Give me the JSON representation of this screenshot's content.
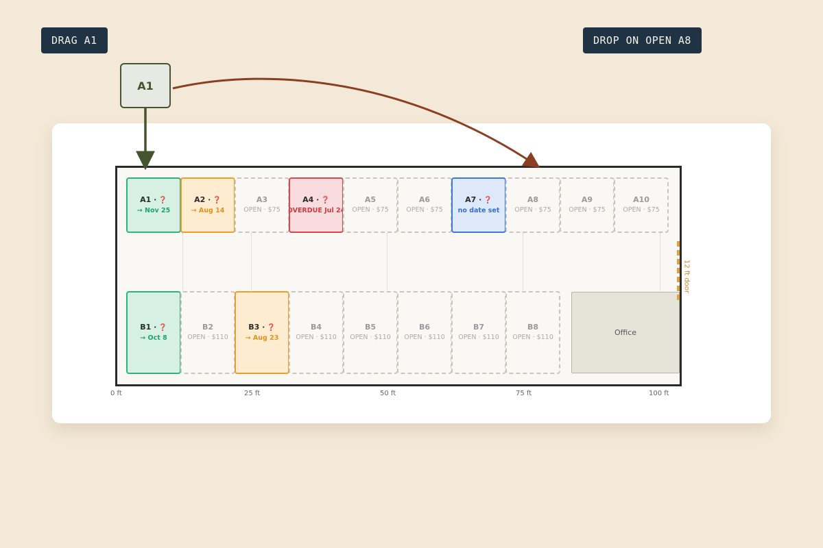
{
  "callouts": {
    "drag": "DRAG A1",
    "drop": "DROP ON OPEN A8"
  },
  "drag_token": {
    "label": "A1"
  },
  "row_a": [
    {
      "id": "A1",
      "label": "A1 ·",
      "flag": "❓",
      "sub": "→ Nov 25",
      "status": "occupied-ok"
    },
    {
      "id": "A2",
      "label": "A2 ·",
      "flag": "❓",
      "sub": "→ Aug 14",
      "status": "occupied-soon"
    },
    {
      "id": "A3",
      "label": "A3",
      "flag": "",
      "sub": "OPEN · $75",
      "status": "open"
    },
    {
      "id": "A4",
      "label": "A4 ·",
      "flag": "❓",
      "sub": "OVERDUE Jul 24",
      "status": "overdue"
    },
    {
      "id": "A5",
      "label": "A5",
      "flag": "",
      "sub": "OPEN · $75",
      "status": "open"
    },
    {
      "id": "A6",
      "label": "A6",
      "flag": "",
      "sub": "OPEN · $75",
      "status": "open"
    },
    {
      "id": "A7",
      "label": "A7 ·",
      "flag": "❓",
      "sub": "no date set",
      "status": "no-date"
    },
    {
      "id": "A8",
      "label": "A8",
      "flag": "",
      "sub": "OPEN · $75",
      "status": "open"
    },
    {
      "id": "A9",
      "label": "A9",
      "flag": "",
      "sub": "OPEN · $75",
      "status": "open"
    },
    {
      "id": "A10",
      "label": "A10",
      "flag": "",
      "sub": "OPEN · $75",
      "status": "open"
    }
  ],
  "row_b": [
    {
      "id": "B1",
      "label": "B1 ·",
      "flag": "❓",
      "sub": "→ Oct 8",
      "status": "occupied-ok"
    },
    {
      "id": "B2",
      "label": "B2",
      "flag": "",
      "sub": "OPEN · $110",
      "status": "open"
    },
    {
      "id": "B3",
      "label": "B3 ·",
      "flag": "❓",
      "sub": "→ Aug 23",
      "status": "occupied-soon"
    },
    {
      "id": "B4",
      "label": "B4",
      "flag": "",
      "sub": "OPEN · $110",
      "status": "open"
    },
    {
      "id": "B5",
      "label": "B5",
      "flag": "",
      "sub": "OPEN · $110",
      "status": "open"
    },
    {
      "id": "B6",
      "label": "B6",
      "flag": "",
      "sub": "OPEN · $110",
      "status": "open"
    },
    {
      "id": "B7",
      "label": "B7",
      "flag": "",
      "sub": "OPEN · $110",
      "status": "open"
    },
    {
      "id": "B8",
      "label": "B8",
      "flag": "",
      "sub": "OPEN · $110",
      "status": "open"
    }
  ],
  "office": {
    "label": "Office"
  },
  "door": {
    "label": "12 ft door"
  },
  "scale_ticks": [
    "0 ft",
    "25 ft",
    "50 ft",
    "75 ft",
    "100 ft"
  ],
  "colors": {
    "occupied-ok": "#2fb27c",
    "occupied-soon": "#e9a02a",
    "overdue": "#d9474b",
    "no-date": "#3c7ad8",
    "open": "#cbc6bd",
    "drag_arrow": "#44542f",
    "drop_arrow": "#8a3f22"
  },
  "icons": {
    "flag": "question-mark-icon"
  }
}
